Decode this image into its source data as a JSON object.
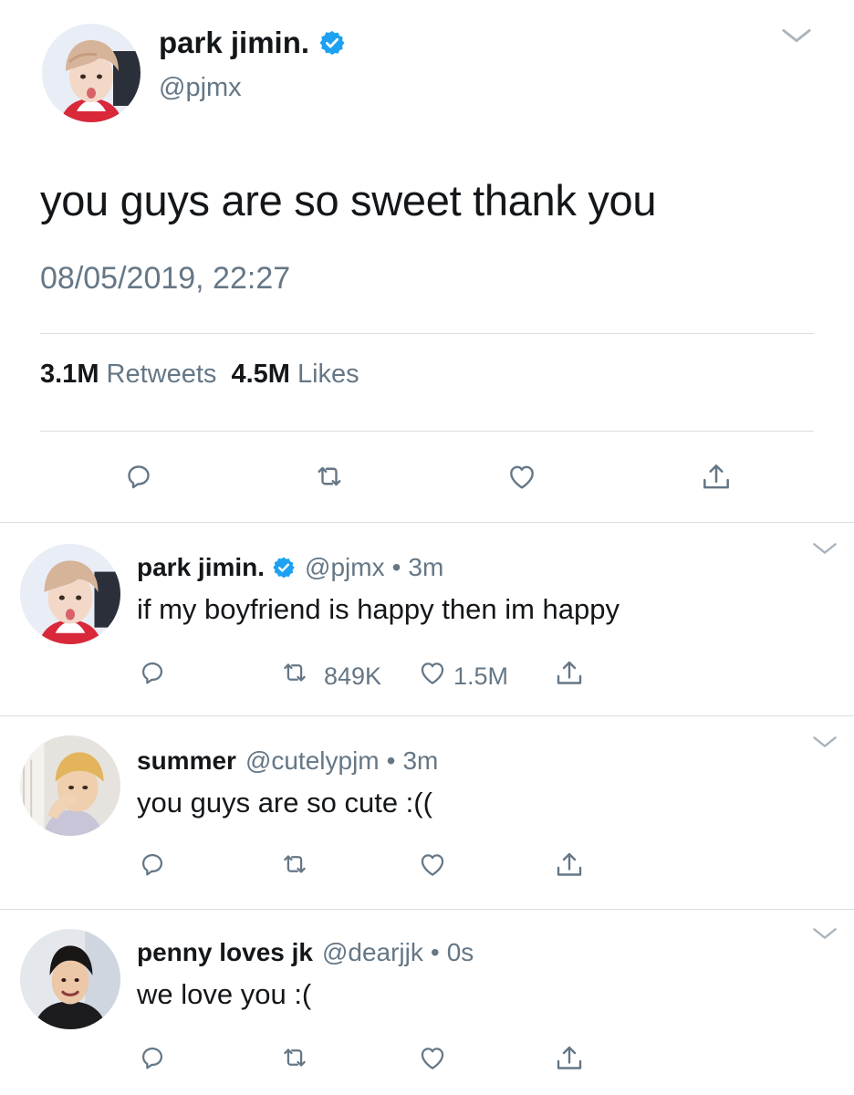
{
  "main_tweet": {
    "name": "park jimin.",
    "handle": "@pjmx",
    "text": "you guys are so sweet thank you",
    "timestamp": "08/05/2019, 22:27",
    "retweets_count": "3.1M",
    "retweets_label": "Retweets",
    "likes_count": "4.5M",
    "likes_label": "Likes",
    "verified": true
  },
  "replies": [
    {
      "name": "park jimin.",
      "verified": true,
      "handle": "@pjmx",
      "separator": "•",
      "time": "3m",
      "text": "if my boyfriend is happy then im happy",
      "retweets": "849K",
      "likes": "1.5M"
    },
    {
      "name": "summer",
      "verified": false,
      "handle": "@cutelypjm",
      "separator": "•",
      "time": "3m",
      "text": "you guys are so cute :(("
    },
    {
      "name": "penny loves jk",
      "verified": false,
      "handle": "@dearjjk",
      "separator": "•",
      "time": "0s",
      "text": "we love you :("
    }
  ],
  "icons": [
    "chevron-down-icon",
    "verified-badge-icon",
    "reply-icon",
    "retweet-icon",
    "like-icon",
    "share-icon"
  ],
  "colors": {
    "text_primary": "#14171a",
    "text_secondary": "#657786",
    "verified_blue": "#1da1f2",
    "divider": "#d8dee3"
  }
}
